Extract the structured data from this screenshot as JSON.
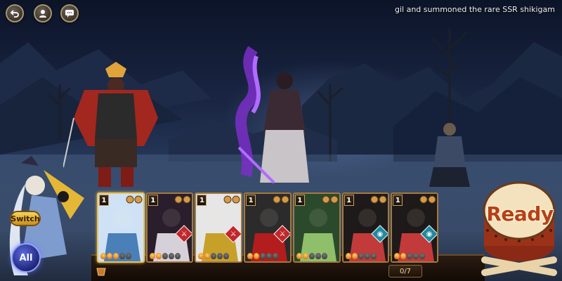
{
  "topbar": {
    "back_icon": "back-arrow-icon",
    "profile_icon": "profile-icon",
    "chat_icon": "chat-icon",
    "ticker_text": "gil and summoned the rare SSR shikigam"
  },
  "battle": {
    "player_characters": [
      "samurai-warrior",
      "blade-wielding-onmyoji"
    ],
    "enemy_characters": [
      "enemy-shikigami"
    ]
  },
  "controls": {
    "switch_label": "Switch",
    "all_label": "All",
    "ready_label": "Ready",
    "counter_text": "0/7"
  },
  "cards": [
    {
      "cost": "1",
      "fire": 3,
      "max_fire": 5,
      "role": "",
      "selected": true,
      "palette": [
        "#cfe2f5",
        "#4a7fb8"
      ]
    },
    {
      "cost": "1",
      "fire": 2,
      "max_fire": 5,
      "role": "attack",
      "selected": false,
      "palette": [
        "#2a1e2c",
        "#d6d0d8"
      ]
    },
    {
      "cost": "1",
      "fire": 2,
      "max_fire": 5,
      "role": "attack",
      "selected": false,
      "palette": [
        "#e6e6e6",
        "#c7a02a"
      ]
    },
    {
      "cost": "1",
      "fire": 2,
      "max_fire": 5,
      "role": "attack",
      "selected": false,
      "palette": [
        "#2b2b2b",
        "#b31d1d"
      ]
    },
    {
      "cost": "1",
      "fire": 2,
      "max_fire": 5,
      "role": "",
      "selected": false,
      "palette": [
        "#2b4a2c",
        "#8fbf6a"
      ]
    },
    {
      "cost": "1",
      "fire": 2,
      "max_fire": 5,
      "role": "support",
      "selected": false,
      "palette": [
        "#1e1a1a",
        "#c23a3a"
      ]
    },
    {
      "cost": "1",
      "fire": 2,
      "max_fire": 5,
      "role": "support",
      "selected": false,
      "palette": [
        "#1e1a1a",
        "#c23a3a"
      ]
    }
  ],
  "colors": {
    "attack_badge": "#c0282c",
    "support_badge": "#1f8aa0",
    "card_border": "#a57a3a"
  }
}
